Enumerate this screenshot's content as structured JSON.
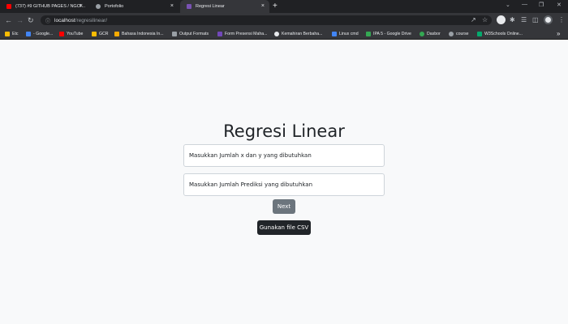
{
  "browser": {
    "tabs": [
      {
        "title": "(737) #9 GITHUB PAGES / NGOI...",
        "favicon_color": "#ff0000",
        "active": false
      },
      {
        "title": "Portofolio",
        "favicon_color": "#9aa0a6",
        "active": false
      },
      {
        "title": "Regresi Linear",
        "favicon_color": "#7952b3",
        "active": true
      }
    ],
    "new_tab_symbol": "+",
    "close_symbol": "×",
    "window_controls": {
      "minimize": "⌄",
      "maximize": "—",
      "restore": "❐",
      "close": "✕"
    },
    "address": {
      "host": "localhost",
      "path": "/regresilinear/"
    },
    "profile_colors": {
      "avatar": "#e8eaed",
      "extension": "#e8eaed"
    }
  },
  "bookmarks": [
    {
      "label": "Etc",
      "icon_color": "#fbbc04"
    },
    {
      "label": "- Google...",
      "icon_color": "#4285f4"
    },
    {
      "label": "YouTube",
      "icon_color": "#ff0000"
    },
    {
      "label": "GCR",
      "icon_color": "#fbbc04"
    },
    {
      "label": "Bahasa Indonesia In...",
      "icon_color": "#f9ab00"
    },
    {
      "label": "Output Formats",
      "icon_color": "#9aa0a6"
    },
    {
      "label": "Form Presensi Maha...",
      "icon_color": "#7248b9"
    },
    {
      "label": "Kemahiran Berbaha...",
      "icon_color": "#e8eaed"
    },
    {
      "label": "Linux cmd",
      "icon_color": "#4285f4"
    },
    {
      "label": "IPA 5 - Google Drive",
      "icon_color": "#34a853"
    },
    {
      "label": "Dasbor",
      "icon_color": "#34a853"
    },
    {
      "label": "course",
      "icon_color": "#9aa0a6"
    },
    {
      "label": "W3Schools Online...",
      "icon_color": "#04aa6d"
    }
  ],
  "bookmarks_overflow": "»",
  "main": {
    "title": "Regresi Linear",
    "x_y_input_placeholder": "Masukkan Jumlah x dan y yang dibutuhkan",
    "prediction_input_placeholder": "Masukkan Jumlah Prediksi yang dibutuhkan",
    "next_label": "Next",
    "csv_label": "Gunakan file CSV"
  }
}
